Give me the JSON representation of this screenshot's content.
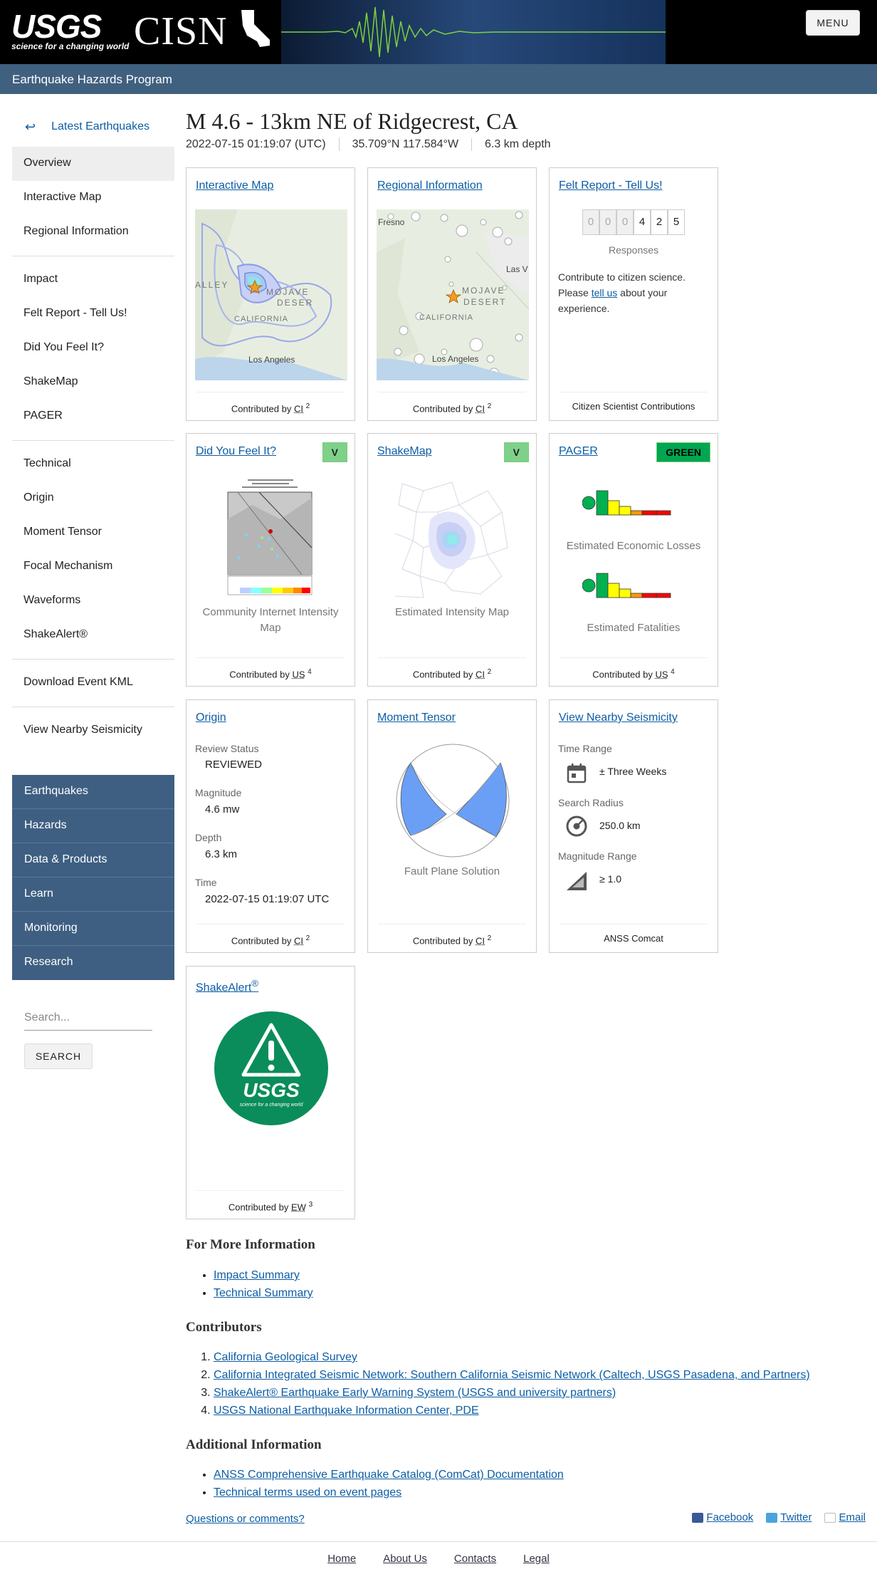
{
  "header": {
    "usgs_word": "USGS",
    "usgs_tagline": "science for a changing world",
    "cisn_word": "CISN",
    "menu_label": "MENU",
    "program": "Earthquake Hazards Program"
  },
  "sidebar": {
    "back_label": "Latest Earthquakes",
    "group1": [
      "Overview",
      "Interactive Map",
      "Regional Information"
    ],
    "group2": [
      "Impact",
      "Felt Report - Tell Us!",
      "Did You Feel It?",
      "ShakeMap",
      "PAGER"
    ],
    "group3": [
      "Technical",
      "Origin",
      "Moment Tensor",
      "Focal Mechanism",
      "Waveforms",
      "ShakeAlert®"
    ],
    "group4": [
      "Download Event KML"
    ],
    "group5": [
      "View Nearby Seismicity"
    ],
    "nav": [
      "Earthquakes",
      "Hazards",
      "Data & Products",
      "Learn",
      "Monitoring",
      "Research"
    ],
    "search_placeholder": "Search...",
    "search_button": "SEARCH"
  },
  "event": {
    "title": "M 4.6 - 13km NE of Ridgecrest, CA",
    "time": "2022-07-15 01:19:07 (UTC)",
    "location": "35.709°N 117.584°W",
    "depth": "6.3 km depth"
  },
  "cards": {
    "interactive_map": {
      "title": "Interactive Map",
      "contrib": "Contributed by",
      "net": "CI",
      "ref": "2",
      "map_labels": [
        "ALLEY",
        "MOJAVE",
        "DESER",
        "CALIFORNIA",
        "Los Angeles"
      ]
    },
    "regional": {
      "title": "Regional Information",
      "contrib": "Contributed by",
      "net": "CI",
      "ref": "2",
      "map_labels": [
        "Fresno",
        "Las V",
        "MOJAVE",
        "DESERT",
        "CALIFORNIA",
        "Los Angeles"
      ]
    },
    "felt": {
      "title": "Felt Report - Tell Us!",
      "digits": [
        "0",
        "0",
        "0",
        "4",
        "2",
        "5"
      ],
      "responses": "Responses",
      "text_pre": "Contribute to citizen science. Please ",
      "text_link": "tell us",
      "text_post": " about your experience.",
      "foot": "Citizen Scientist Contributions"
    },
    "dyfi": {
      "title": "Did You Feel It?",
      "badge": "V",
      "caption": "Community Internet Intensity Map",
      "contrib": "Contributed by",
      "net": "US",
      "ref": "4"
    },
    "shakemap": {
      "title": "ShakeMap",
      "badge": "V",
      "caption": "Estimated Intensity Map",
      "contrib": "Contributed by",
      "net": "CI",
      "ref": "2"
    },
    "pager": {
      "title": "PAGER",
      "badge": "GREEN",
      "caption1": "Estimated Economic Losses",
      "caption2": "Estimated Fatalities",
      "contrib": "Contributed by",
      "net": "US",
      "ref": "4"
    },
    "origin": {
      "title": "Origin",
      "rows": [
        {
          "label": "Review Status",
          "value": "REVIEWED"
        },
        {
          "label": "Magnitude",
          "value": "4.6 mw"
        },
        {
          "label": "Depth",
          "value": "6.3 km"
        },
        {
          "label": "Time",
          "value": "2022-07-15 01:19:07 UTC"
        }
      ],
      "contrib": "Contributed by",
      "net": "CI",
      "ref": "2"
    },
    "moment": {
      "title": "Moment Tensor",
      "caption": "Fault Plane Solution",
      "contrib": "Contributed by",
      "net": "CI",
      "ref": "2"
    },
    "nearby": {
      "title": "View Nearby Seismicity",
      "rows": [
        {
          "label": "Time Range",
          "value": "± Three Weeks",
          "icon": "calendar-icon"
        },
        {
          "label": "Search Radius",
          "value": "250.0 km",
          "icon": "radius-icon"
        },
        {
          "label": "Magnitude Range",
          "value": "≥ 1.0",
          "icon": "magnitude-icon"
        }
      ],
      "foot": "ANSS Comcat"
    },
    "shakealert": {
      "title": "ShakeAlert",
      "reg": "®",
      "logo_word": "USGS",
      "logo_tag": "science for a changing world",
      "contrib": "Contributed by",
      "net": "EW",
      "ref": "3"
    }
  },
  "more_info": {
    "heading": "For More Information",
    "links": [
      "Impact Summary",
      "Technical Summary"
    ]
  },
  "contributors": {
    "heading": "Contributors",
    "links": [
      "California Geological Survey",
      "California Integrated Seismic Network: Southern California Seismic Network (Caltech, USGS Pasadena, and Partners)",
      "ShakeAlert® Earthquake Early Warning System (USGS and university partners)",
      "USGS National Earthquake Information Center, PDE"
    ]
  },
  "additional": {
    "heading": "Additional Information",
    "links": [
      "ANSS Comprehensive Earthquake Catalog (ComCat) Documentation",
      "Technical terms used on event pages"
    ]
  },
  "questions": "Questions or comments?",
  "social": {
    "facebook": "Facebook",
    "twitter": "Twitter",
    "email": "Email"
  },
  "footer": [
    "Home",
    "About Us",
    "Contacts",
    "Legal"
  ],
  "colors": {
    "nav_blue": "#3e5f82",
    "subbar": "#40607f",
    "link": "#0c5da5",
    "pager_green": "#00a651"
  }
}
